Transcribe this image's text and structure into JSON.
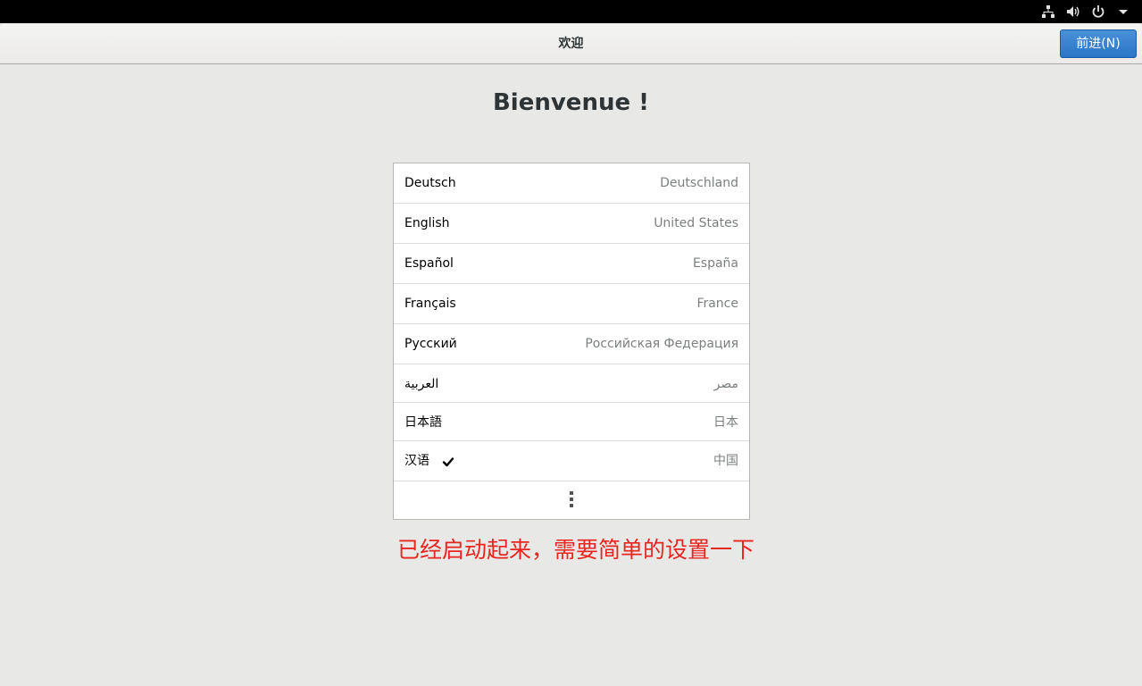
{
  "system_tray": {
    "network_icon": "network-icon",
    "volume_icon": "volume-icon",
    "power_icon": "power-icon",
    "menu_arrow_icon": "chevron-down-icon"
  },
  "header": {
    "title": "欢迎",
    "next_button_label": "前进(N)"
  },
  "welcome_heading": "Bienvenue !",
  "languages": [
    {
      "name": "Deutsch",
      "region": "Deutschland",
      "selected": false
    },
    {
      "name": "English",
      "region": "United States",
      "selected": false
    },
    {
      "name": "Español",
      "region": "España",
      "selected": false
    },
    {
      "name": "Français",
      "region": "France",
      "selected": false
    },
    {
      "name": "Русский",
      "region": "Российская Федерация",
      "selected": false
    },
    {
      "name": "العربية",
      "region": "مصر",
      "selected": false
    },
    {
      "name": "日本語",
      "region": "日本",
      "selected": false
    },
    {
      "name": "汉语",
      "region": "中国",
      "selected": true
    }
  ],
  "more_icon": "more-vertical-icon",
  "annotation_text": "已经启动起来，需要简单的设置一下",
  "colors": {
    "accent": "#2a76c6",
    "annotation": "#e8251f",
    "background": "#e8e8e7"
  }
}
